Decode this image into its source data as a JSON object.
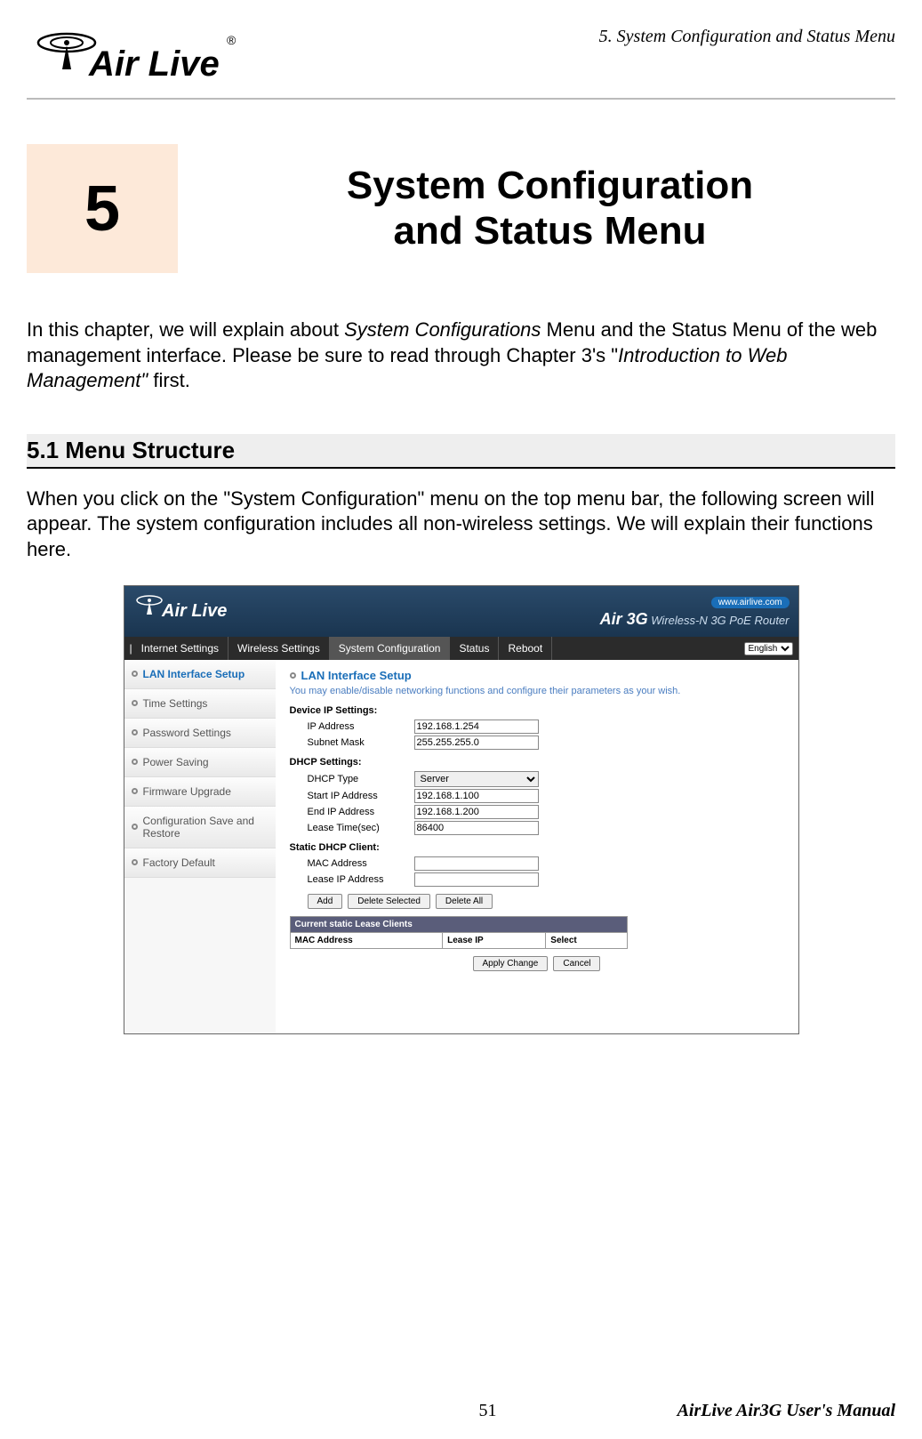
{
  "header": {
    "running_head": "5. System Configuration and Status Menu",
    "logo_text": "Air Live"
  },
  "chapter": {
    "number": "5",
    "title_line1": "System Configuration",
    "title_line2": "and Status Menu"
  },
  "intro": {
    "part1": "In this chapter, we will explain about ",
    "italic1": "System Configurations",
    "part2": " Menu and the Status Menu of the web management interface.    Please be sure to read through Chapter 3's \"",
    "italic2": "Introduction to Web Management\"",
    "part3": " first."
  },
  "section": {
    "heading": "5.1 Menu  Structure",
    "body": "When you click on the \"System Configuration\" menu on the top menu bar, the following screen will appear.    The system configuration includes all non-wireless settings.    We will explain their functions here."
  },
  "screenshot": {
    "logo": "Air Live",
    "url_badge": "www.airlive.com",
    "model": "Air 3G",
    "model_sub": "Wireless-N 3G PoE Router",
    "nav": [
      "Internet Settings",
      "Wireless Settings",
      "System Configuration",
      "Status",
      "Reboot"
    ],
    "lang_label": "English",
    "sidebar": [
      "LAN Interface Setup",
      "Time Settings",
      "Password Settings",
      "Power Saving",
      "Firmware Upgrade",
      "Configuration Save and Restore",
      "Factory Default"
    ],
    "content_title": "LAN Interface Setup",
    "content_desc": "You may enable/disable networking functions and configure their parameters as your wish.",
    "device_ip_label": "Device IP Settings:",
    "ip_address_label": "IP Address",
    "ip_address_value": "192.168.1.254",
    "subnet_label": "Subnet Mask",
    "subnet_value": "255.255.255.0",
    "dhcp_label": "DHCP Settings:",
    "dhcp_type_label": "DHCP Type",
    "dhcp_type_value": "Server",
    "start_ip_label": "Start IP Address",
    "start_ip_value": "192.168.1.100",
    "end_ip_label": "End IP Address",
    "end_ip_value": "192.168.1.200",
    "lease_label": "Lease Time(sec)",
    "lease_value": "86400",
    "static_label": "Static DHCP Client:",
    "mac_label": "MAC Address",
    "lease_ip_label": "Lease IP Address",
    "btn_add": "Add",
    "btn_del_sel": "Delete Selected",
    "btn_del_all": "Delete All",
    "table_caption": "Current static Lease Clients",
    "table_h1": "MAC Address",
    "table_h2": "Lease IP",
    "table_h3": "Select",
    "btn_apply": "Apply Change",
    "btn_cancel": "Cancel"
  },
  "footer": {
    "page_num": "51",
    "manual_title": "AirLive Air3G User's Manual"
  }
}
